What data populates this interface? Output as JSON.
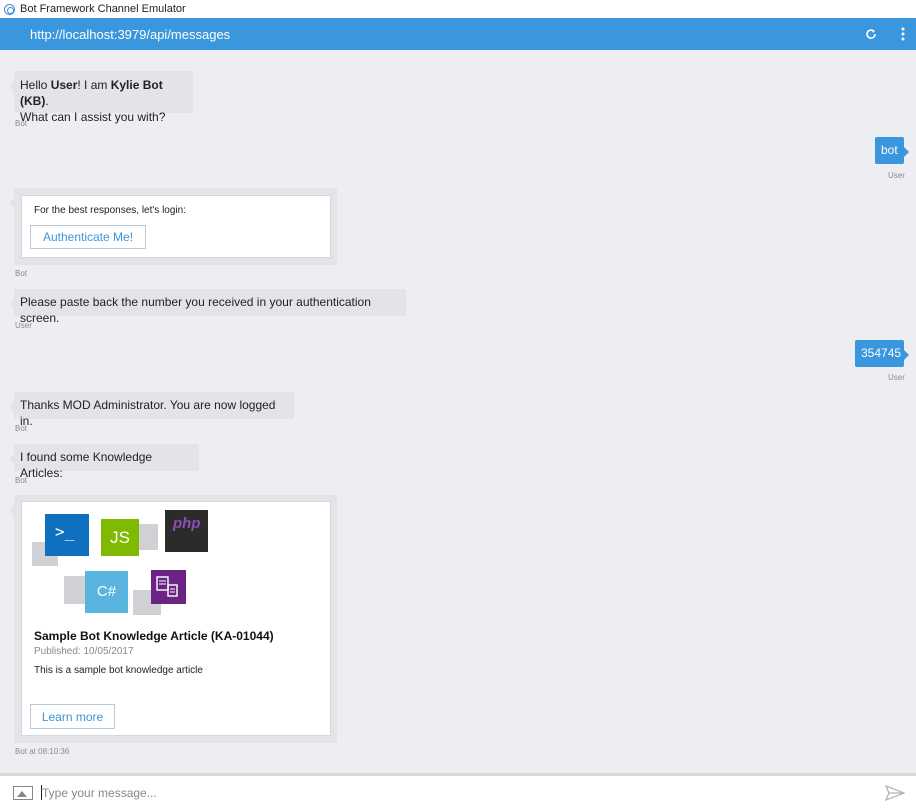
{
  "window": {
    "title": "Bot Framework Channel Emulator"
  },
  "address": {
    "url": "http://localhost:3979/api/messages",
    "refresh_icon": "refresh-icon",
    "more_icon": "more-vertical-icon"
  },
  "messages": {
    "m1": {
      "pre1": "Hello ",
      "bold1": "User",
      "mid": "! I am ",
      "bold2": "Kylie Bot (KB)",
      "post": ".",
      "line2": "What can I assist you with?",
      "meta": "Bot"
    },
    "m2": {
      "text": "bot",
      "meta": "User"
    },
    "m3": {
      "text": "For the best responses, let's login:",
      "button": "Authenticate Me!",
      "meta": "Bot"
    },
    "m4": {
      "text": "Please paste back the number you received in your authentication screen.",
      "meta": "User"
    },
    "m5": {
      "text": "354745",
      "meta": "User"
    },
    "m6": {
      "text": "Thanks MOD Administrator. You are now logged in.",
      "meta": "Bot"
    },
    "m7": {
      "text": "I found some Knowledge Articles:",
      "meta": "Bot"
    },
    "m8": {
      "title": "Sample Bot Knowledge Article (KA-01044)",
      "published": "Published: 10/05/2017",
      "body": "This is a sample bot knowledge article",
      "button": "Learn more",
      "meta": "Bot at 08:10:36",
      "tiles": {
        "powershell": ">_",
        "js": "JS",
        "php": "php",
        "csharp": "C#"
      }
    }
  },
  "input": {
    "placeholder": "Type your message...",
    "image_icon": "image-upload-icon",
    "send_icon": "send-icon"
  },
  "colors": {
    "accent": "#3a96dd",
    "chat_bg": "#eceef1",
    "bubble_bg": "#e2e4e8"
  }
}
